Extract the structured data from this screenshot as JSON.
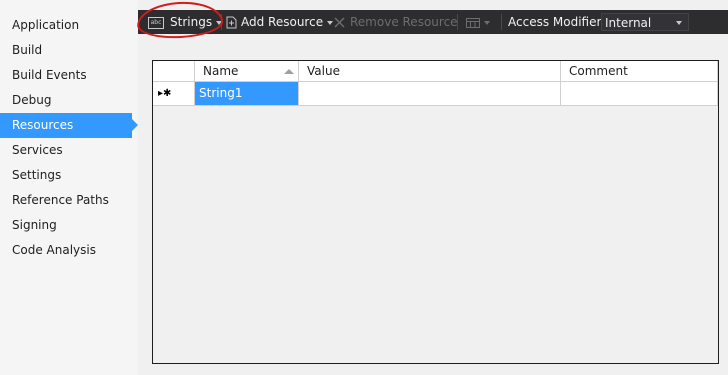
{
  "sidebar": {
    "items": [
      {
        "label": "Application"
      },
      {
        "label": "Build"
      },
      {
        "label": "Build Events"
      },
      {
        "label": "Debug"
      },
      {
        "label": "Resources"
      },
      {
        "label": "Services"
      },
      {
        "label": "Settings"
      },
      {
        "label": "Reference Paths"
      },
      {
        "label": "Signing"
      },
      {
        "label": "Code Analysis"
      }
    ],
    "active_index": 4
  },
  "toolbar": {
    "resource_type_icon_text": "abc",
    "resource_type_label": "Strings",
    "add_resource_label": "Add Resource",
    "remove_resource_label": "Remove Resource",
    "access_modifier_label": "Access Modifier:",
    "access_modifier_value": "Internal"
  },
  "grid": {
    "columns": [
      "Name",
      "Value",
      "Comment"
    ],
    "rows": [
      {
        "marker": "▸✱",
        "name": "String1",
        "value": "",
        "comment": ""
      }
    ]
  },
  "colors": {
    "accent": "#3399ff",
    "toolbar_bg": "#2d2d30",
    "annotation": "#d41b1b"
  }
}
